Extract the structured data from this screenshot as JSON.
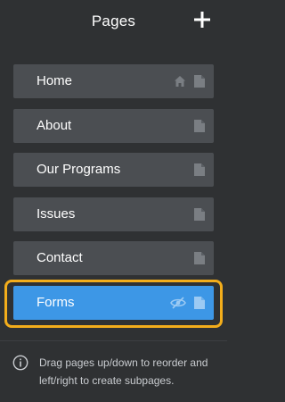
{
  "header": {
    "title": "Pages",
    "add_icon": "plus-icon"
  },
  "pages": [
    {
      "label": "Home",
      "icons": [
        "home-icon",
        "page-icon"
      ],
      "active": false
    },
    {
      "label": "About",
      "icons": [
        "page-icon"
      ],
      "active": false
    },
    {
      "label": "Our Programs",
      "icons": [
        "page-icon"
      ],
      "active": false
    },
    {
      "label": "Issues",
      "icons": [
        "page-icon"
      ],
      "active": false
    },
    {
      "label": "Contact",
      "icons": [
        "page-icon"
      ],
      "active": false
    },
    {
      "label": "Forms",
      "icons": [
        "hidden-eye-icon",
        "page-icon"
      ],
      "active": true
    }
  ],
  "hint": {
    "icon": "info-icon",
    "text": "Drag pages up/down to reorder and left/right to create subpages."
  },
  "colors": {
    "background": "#2f3133",
    "item": "#4b4e52",
    "active": "#3d97e6",
    "highlight": "#f3ad1b"
  }
}
